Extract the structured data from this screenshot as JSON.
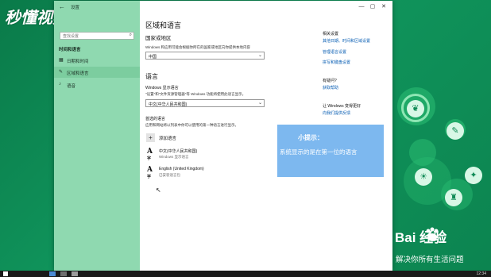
{
  "window": {
    "title": "设置",
    "back_icon": "back-arrow-icon",
    "controls": [
      "—",
      "▢",
      "✕"
    ]
  },
  "sidebar": {
    "search_placeholder": "查找设置",
    "heading": "时间和语言",
    "items": [
      {
        "icon": "calendar-icon",
        "label": "日期和时间",
        "active": false
      },
      {
        "icon": "region-language-icon",
        "label": "区域和语言",
        "active": true
      },
      {
        "icon": "microphone-icon",
        "label": "语音",
        "active": false
      }
    ]
  },
  "main": {
    "title": "区域和语言",
    "country": {
      "heading": "国家或地区",
      "desc": "Windows 和应用可能会根据你所在的国家或地区向你提供本地内容",
      "selected": "中国"
    },
    "language": {
      "heading": "语言",
      "display_heading": "Windows 显示语言",
      "display_desc": "\"设置\"和\"文件资源管理器\"等 Windows 功能将使用此语言显示。",
      "display_selected": "中文(中华人民共和国)",
      "preferred_heading": "首选的语言",
      "preferred_desc": "应用和网站将以列表中你可以使用的第一种语言进行显示。",
      "add_label": "添加语言",
      "entries": [
        {
          "name": "中文(中华人民共和国)",
          "sub": "Windows 显示语言",
          "features": "✎ ⊕ ◎ ▭"
        },
        {
          "name": "English (United Kingdom)",
          "sub": "已安装语言包",
          "features": "⊕ ◎ ▭"
        }
      ]
    }
  },
  "related": {
    "heading": "相关设置",
    "links": [
      "其他日期、时间和区域设置",
      "管理语言设置",
      "拼写和键盘设置"
    ],
    "question_heading": "有疑问?",
    "question_link": "获取帮助",
    "better_heading": "让 Windows 变得更好",
    "better_link": "向我们提供反馈"
  },
  "tip": {
    "title": "小提示：",
    "body": "系统显示的是在第一位的语言"
  },
  "watermark": {
    "logo": "秒懂视频",
    "baidu": "Bai 经验",
    "slogan": "解决你所有生活问题"
  },
  "taskbar": {
    "time": "12:34"
  }
}
